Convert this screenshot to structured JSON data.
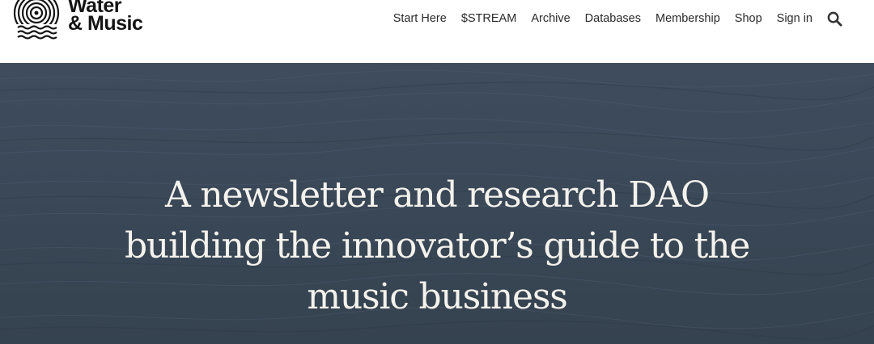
{
  "brand": {
    "name_line1": "Water",
    "name_line2": "& Music",
    "logo_icon": "vinyl-waves-icon"
  },
  "nav": {
    "items": [
      {
        "label": "Start Here"
      },
      {
        "label": "$STREAM"
      },
      {
        "label": "Archive"
      },
      {
        "label": "Databases"
      },
      {
        "label": "Membership"
      },
      {
        "label": "Shop"
      },
      {
        "label": "Sign in"
      }
    ],
    "search_icon": "search-icon"
  },
  "hero": {
    "title": "A newsletter and research DAO building the innovator’s guide to the music business",
    "background_color": "#3c4a5b",
    "text_color": "#f4f2ec"
  }
}
